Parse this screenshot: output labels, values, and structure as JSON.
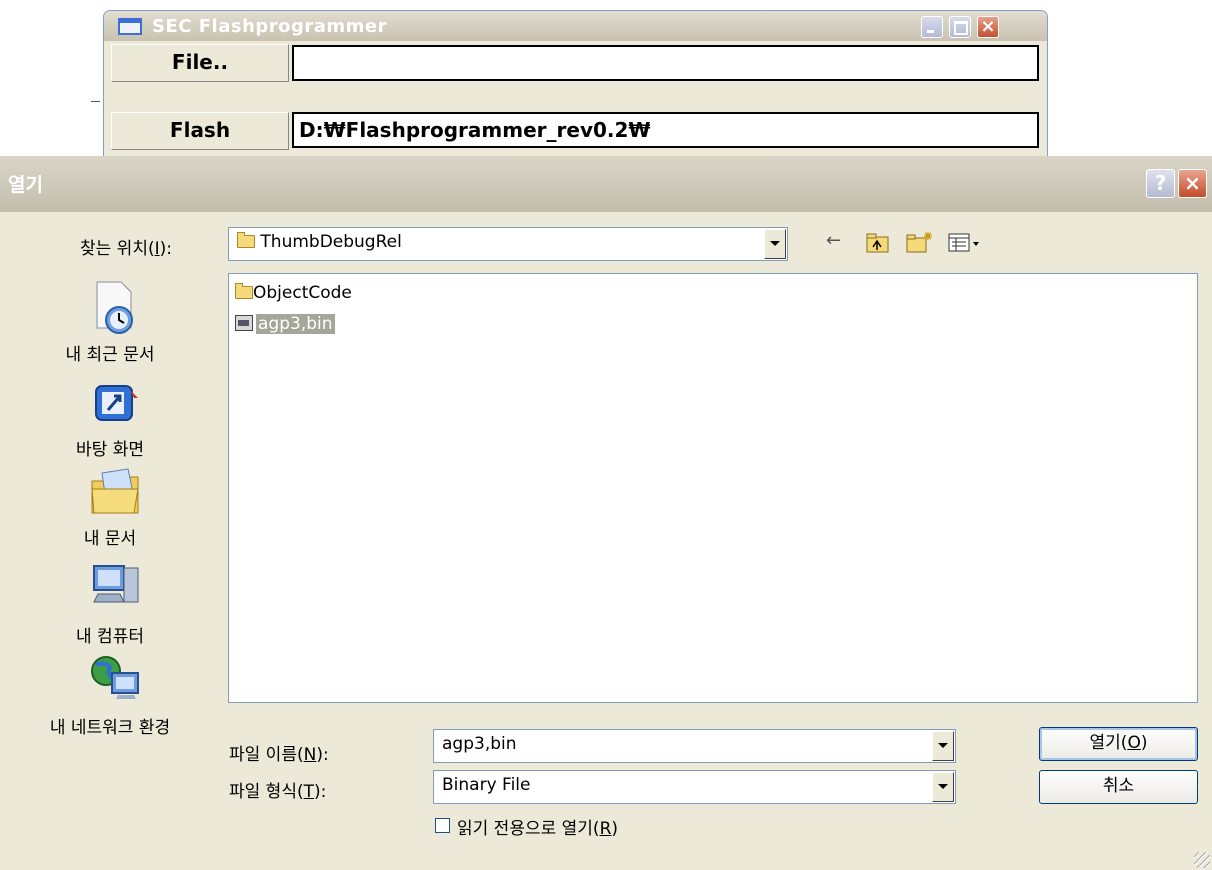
{
  "background_window": {
    "title": "SEC Flashprogrammer",
    "file_button": "File..",
    "file_path": "",
    "flash_button": "Flash",
    "flash_path": "D:₩Flashprogrammer_rev0.2₩",
    "controls": {
      "minimize": "minimize-icon",
      "maximize": "maximize-icon",
      "close": "×"
    }
  },
  "dialog": {
    "title": "열기",
    "help_glyph": "?",
    "close_glyph": "×",
    "look_in_label": "찾는 위치(",
    "look_in_key": "I",
    "look_in_suffix": "):",
    "look_in_value": "ThumbDebugRel",
    "toolbar": {
      "back": "←",
      "up": "up-folder-icon",
      "new_folder": "new-folder-icon",
      "views": "view-menu-icon"
    },
    "places": [
      {
        "label": "내 최근 문서",
        "icon": "recent-documents-icon"
      },
      {
        "label": "바탕 화면",
        "icon": "desktop-icon"
      },
      {
        "label": "내 문서",
        "icon": "my-documents-icon"
      },
      {
        "label": "내 컴퓨터",
        "icon": "my-computer-icon"
      },
      {
        "label": "내 네트워크 환경",
        "icon": "network-places-icon"
      }
    ],
    "files": [
      {
        "name": "ObjectCode",
        "type": "folder"
      },
      {
        "name": "agp3,bin",
        "type": "file",
        "selected": true
      }
    ],
    "filename_label": "파일 이름(",
    "filename_key": "N",
    "filename_suffix": "):",
    "filename_value": "agp3,bin",
    "filetype_label": "파일 형식(",
    "filetype_key": "T",
    "filetype_suffix": "):",
    "filetype_value": "Binary File",
    "readonly_label": "읽기 전용으로 열기(",
    "readonly_key": "R",
    "readonly_suffix": ")",
    "readonly_checked": false,
    "open_button": "열기(",
    "open_key": "O",
    "open_suffix": ")",
    "cancel_button": "취소"
  }
}
